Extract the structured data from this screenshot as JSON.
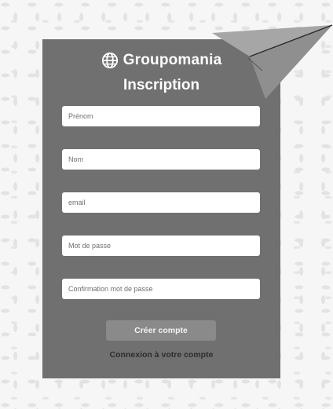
{
  "brand": {
    "name": "Groupomania",
    "icon": "globe-icon"
  },
  "form": {
    "title": "Inscription",
    "fields": {
      "firstname": {
        "placeholder": "Prénom",
        "value": ""
      },
      "lastname": {
        "placeholder": "Nom",
        "value": ""
      },
      "email": {
        "placeholder": "email",
        "value": ""
      },
      "password": {
        "placeholder": "Mot de passe",
        "value": ""
      },
      "password_confirm": {
        "placeholder": "Confirmation mot de passe",
        "value": ""
      }
    },
    "submit_label": "Créer compte",
    "login_link": "Connexion à votre compte"
  },
  "decoration": {
    "paper_plane_icon": "paper-plane-icon"
  },
  "colors": {
    "card": "#707070",
    "button": "#8a8a8a",
    "page_background": "#f6f6f6",
    "plane": "#9b9b9b"
  }
}
